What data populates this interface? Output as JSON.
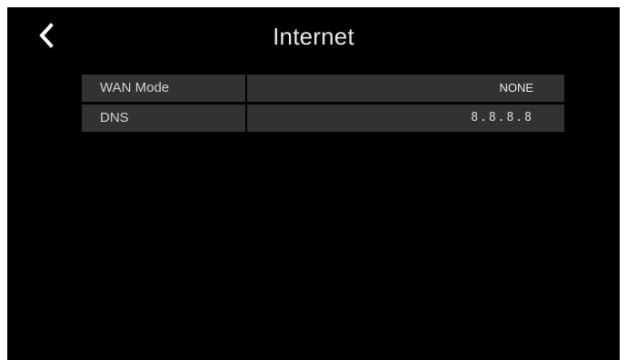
{
  "header": {
    "title": "Internet",
    "back_icon": "chevron-left-icon"
  },
  "settings": [
    {
      "label": "WAN Mode",
      "value": "NONE"
    },
    {
      "label": "DNS",
      "value": "8.8.8.8"
    }
  ],
  "colors": {
    "background": "#000000",
    "row_background": "#323232",
    "text": "#e6e6e6"
  }
}
